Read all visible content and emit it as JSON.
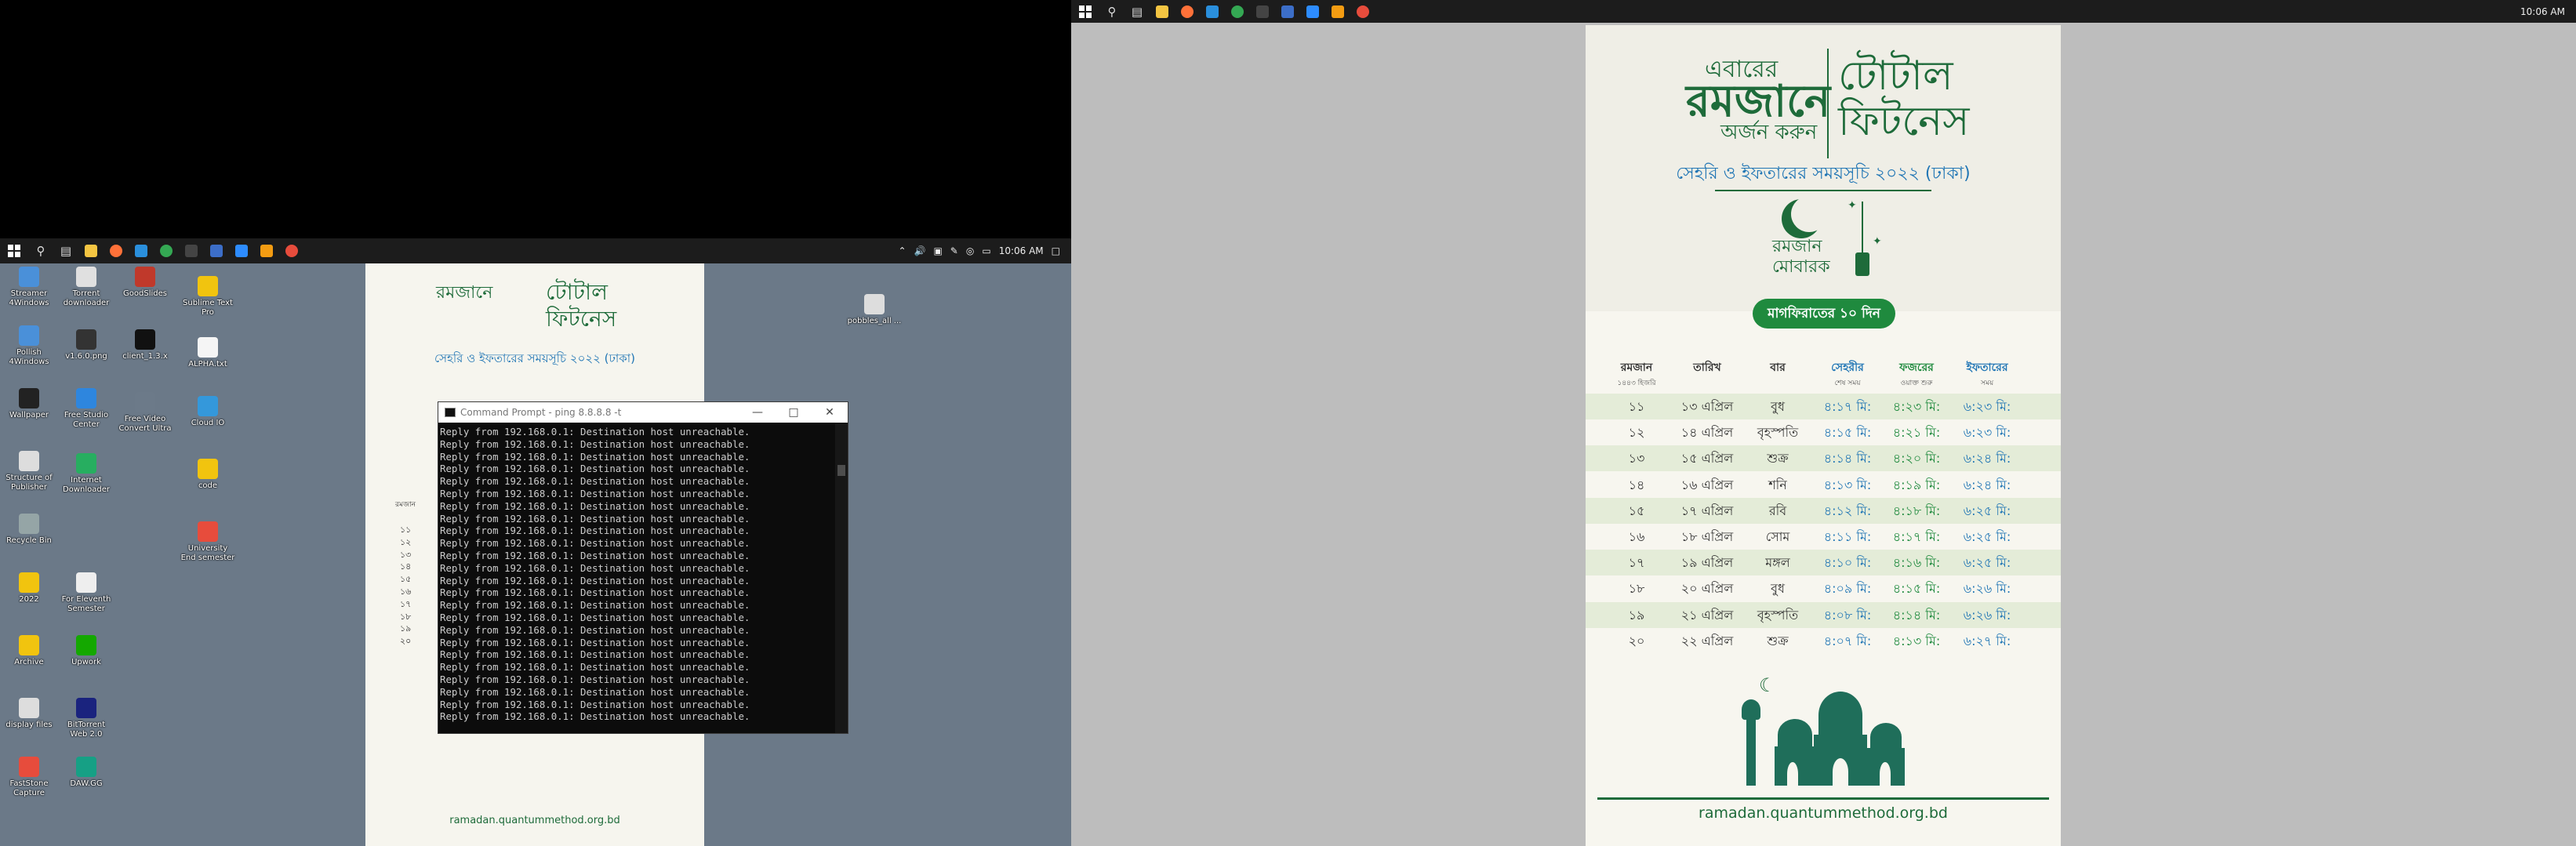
{
  "left_taskbar": {
    "time": "10:06 AM",
    "tray_icons": [
      "chevron-up-icon",
      "volume-icon",
      "usb-icon",
      "pen-icon",
      "network-icon",
      "battery-icon",
      "notification-icon"
    ]
  },
  "right_taskbar": {
    "time": "10:06 AM"
  },
  "desktop_icons": [
    {
      "label": "Streamer 4Windows",
      "color": "#4a90d9"
    },
    {
      "label": "Torrent downloader",
      "color": "#e0e0e0"
    },
    {
      "label": "GoodSlides",
      "color": "#c0392b"
    },
    {
      "label": "Sublime Text Pro",
      "color": "#f1c40f"
    },
    {
      "label": "Pollish 4Windows",
      "color": "#4a90d9"
    },
    {
      "label": "v1.6.0.png",
      "color": "#333333"
    },
    {
      "label": "client_1.3.x",
      "color": "#111111"
    },
    {
      "label": "ALPHA.txt",
      "color": "#f5f5f5"
    },
    {
      "label": "Wallpaper",
      "color": "#222222"
    },
    {
      "label": "Free Studio Center",
      "color": "#2e86de"
    },
    {
      "label": "Free Video Convert Ultra",
      "color": "#6c7a89"
    },
    {
      "label": "Cloud IO",
      "color": "#3498db"
    },
    {
      "label": "Structure of Publisher",
      "color": "#dddddd"
    },
    {
      "label": "Internet Downloader",
      "color": "#27ae60"
    },
    {
      "label": "code",
      "color": "#f1c40f"
    },
    {
      "label": "Recycle Bin",
      "color": "#95a5a6"
    },
    {
      "label": "University End semester",
      "color": "#e74c3c"
    },
    {
      "label": "2022",
      "color": "#f1c40f"
    },
    {
      "label": "For Eleventh Semester",
      "color": "#eeeeee"
    },
    {
      "label": "Archive",
      "color": "#f1c40f"
    },
    {
      "label": "Upwork",
      "color": "#14a800"
    },
    {
      "label": "display files",
      "color": "#dddddd"
    },
    {
      "label": "BitTorrent Web 2.0",
      "color": "#1a237e"
    },
    {
      "label": "FastStone Capture",
      "color": "#e74c3c"
    },
    {
      "label": "DAW.GG",
      "color": "#16a085"
    },
    {
      "label": "pobbles_all ...",
      "color": "#dddddd"
    }
  ],
  "cmd": {
    "title": "Command Prompt - ping 8.8.8.8 -t",
    "lines": [
      "Reply from 192.168.0.1: Destination host unreachable.",
      "Reply from 192.168.0.1: Destination host unreachable.",
      "Reply from 192.168.0.1: Destination host unreachable.",
      "Reply from 192.168.0.1: Destination host unreachable.",
      "Reply from 192.168.0.1: Destination host unreachable.",
      "Reply from 192.168.0.1: Destination host unreachable.",
      "Reply from 192.168.0.1: Destination host unreachable.",
      "Reply from 192.168.0.1: Destination host unreachable.",
      "Reply from 192.168.0.1: Destination host unreachable.",
      "Reply from 192.168.0.1: Destination host unreachable.",
      "Reply from 192.168.0.1: Destination host unreachable.",
      "Reply from 192.168.0.1: Destination host unreachable.",
      "Reply from 192.168.0.1: Destination host unreachable.",
      "Reply from 192.168.0.1: Destination host unreachable.",
      "Reply from 192.168.0.1: Destination host unreachable.",
      "Reply from 192.168.0.1: Destination host unreachable.",
      "Reply from 192.168.0.1: Destination host unreachable.",
      "Reply from 192.168.0.1: Destination host unreachable.",
      "Reply from 192.168.0.1: Destination host unreachable.",
      "Reply from 192.168.0.1: Destination host unreachable.",
      "Reply from 192.168.0.1: Destination host unreachable.",
      "Reply from 192.168.0.1: Destination host unreachable.",
      "Reply from 192.168.0.1: Destination host unreachable.",
      "Reply from 192.168.0.1: Destination host unreachable."
    ]
  },
  "poster": {
    "ebarer": "এবারের",
    "ramjane": "রমজানে",
    "arjon": "অর্জন করুন",
    "total1": "টোটাল",
    "total2": "ফিটনেস",
    "subtitle": "সেহরি ও ইফতারের সময়সূচি ২০২২ (ঢাকা)",
    "ramadan1": "রমজান",
    "ramadan2": "মোবারক",
    "pill": "মাগফিরাতের ১০ দিন",
    "headers": [
      {
        "h1": "রমজান",
        "h2": "১৪৪৩ হিজরি",
        "color": "#333333"
      },
      {
        "h1": "তারিখ",
        "h2": "",
        "color": "#333333"
      },
      {
        "h1": "বার",
        "h2": "",
        "color": "#333333"
      },
      {
        "h1": "সেহরীর",
        "h2": "শেষ সময়",
        "color": "#2176b5"
      },
      {
        "h1": "ফজরের",
        "h2": "ওয়াক্ত শুরু",
        "color": "#1f8a3e"
      },
      {
        "h1": "ইফতারের",
        "h2": "সময়",
        "color": "#2176b5"
      }
    ],
    "rows": [
      [
        "১১",
        "১৩ এপ্রিল",
        "বুধ",
        "৪:১৭ মি:",
        "৪:২৩ মি:",
        "৬:২৩ মি:"
      ],
      [
        "১২",
        "১৪ এপ্রিল",
        "বৃহস্পতি",
        "৪:১৫ মি:",
        "৪:২১ মি:",
        "৬:২৩ মি:"
      ],
      [
        "১৩",
        "১৫ এপ্রিল",
        "শুক্র",
        "৪:১৪ মি:",
        "৪:২০ মি:",
        "৬:২৪ মি:"
      ],
      [
        "১৪",
        "১৬ এপ্রিল",
        "শনি",
        "৪:১৩ মি:",
        "৪:১৯ মি:",
        "৬:২৪ মি:"
      ],
      [
        "১৫",
        "১৭ এপ্রিল",
        "রবি",
        "৪:১২ মি:",
        "৪:১৮ মি:",
        "৬:২৫ মি:"
      ],
      [
        "১৬",
        "১৮ এপ্রিল",
        "সোম",
        "৪:১১ মি:",
        "৪:১৭ মি:",
        "৬:২৫ মি:"
      ],
      [
        "১৭",
        "১৯ এপ্রিল",
        "মঙ্গল",
        "৪:১০ মি:",
        "৪:১৬ মি:",
        "৬:২৫ মি:"
      ],
      [
        "১৮",
        "২০ এপ্রিল",
        "বুধ",
        "৪:০৯ মি:",
        "৪:১৫ মি:",
        "৬:২৬ মি:"
      ],
      [
        "১৯",
        "২১ এপ্রিল",
        "বৃহস্পতি",
        "৪:০৮ মি:",
        "৪:১৪ মি:",
        "৬:২৬ মি:"
      ],
      [
        "২০",
        "২২ এপ্রিল",
        "শুক্র",
        "৪:০৭ মি:",
        "৪:১৩ মি:",
        "৬:২৭ মি:"
      ]
    ],
    "url": "ramadan.quantummethod.org.bd"
  },
  "left_poster": {
    "rows": [
      "১১",
      "১২",
      "১৩",
      "১৪",
      "১৫",
      "১৬",
      "১৭",
      "১৮",
      "১৯",
      "২০"
    ],
    "header": "রমজান"
  }
}
